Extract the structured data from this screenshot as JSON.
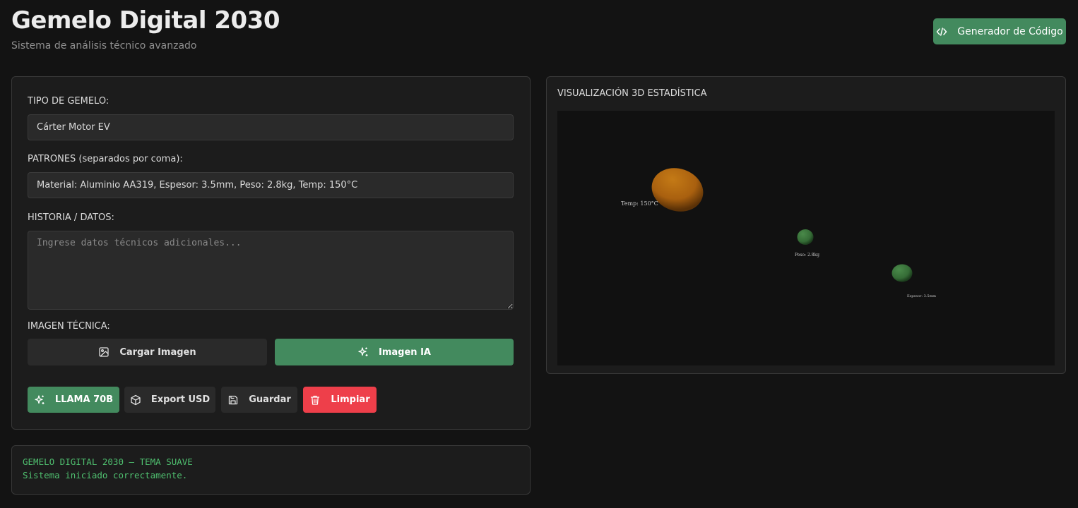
{
  "header": {
    "title": "Gemelo Digital 2030",
    "subtitle": "Sistema de análisis técnico avanzado",
    "code_button": "Generador de Código"
  },
  "form": {
    "type_label": "TIPO DE GEMELO:",
    "type_value": "Cárter Motor EV",
    "patterns_label": "PATRONES (separados por coma):",
    "patterns_value": "Material: Aluminio AA319, Espesor: 3.5mm, Peso: 2.8kg, Temp: 150°C",
    "history_label": "HISTORIA / DATOS:",
    "history_placeholder": "Ingrese datos técnicos adicionales...",
    "image_label": "IMAGEN TÉCNICA:",
    "upload_button": "Cargar Imagen",
    "ai_image_button": "Imagen IA"
  },
  "actions": {
    "llama": "LLAMA 70B",
    "export": "Export USD",
    "save": "Guardar",
    "clear": "Limpiar"
  },
  "visualization": {
    "title": "VISUALIZACIÓN 3D ESTADÍSTICA",
    "labels": {
      "temp": "Temp: 150°C",
      "weight": "Peso: 2.8kg",
      "thickness": "Espesor: 3.5mm"
    }
  },
  "console": {
    "line1": "GEMELO DIGITAL 2030 — TEMA SUAVE",
    "line2": "Sistema iniciado correctamente."
  },
  "colors": {
    "accent_green": "#438a5e",
    "danger_red": "#ee3f4a",
    "console_green": "#4fbf6f",
    "sphere_orange": "#b86a12",
    "sphere_green": "#3d7a3f"
  }
}
